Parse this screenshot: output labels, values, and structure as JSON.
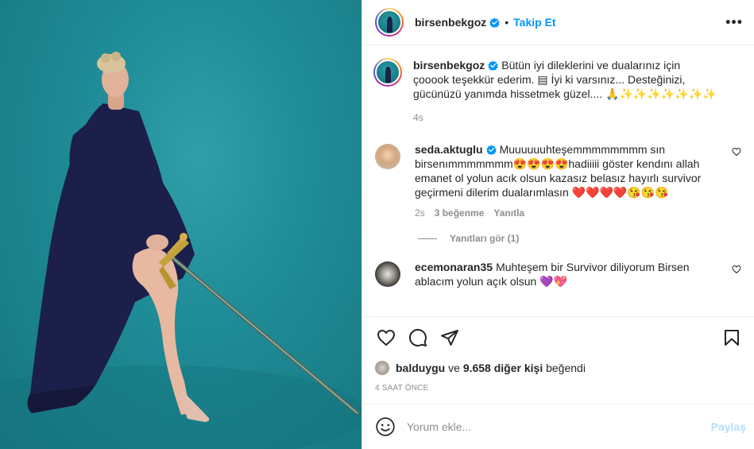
{
  "header": {
    "username": "birsenbekgoz",
    "separator": "•",
    "follow_label": "Takip Et",
    "more_label": "•••"
  },
  "caption": {
    "username": "birsenbekgoz",
    "text": "Bütün iyi dileklerini ve dualarınız için çooook teşekkür ederim. ▤ İyi ki varsınız... Desteğinizi, gücünüzü yanımda hissetmek güzel.... 🙏✨✨✨✨✨✨✨",
    "time": "4s"
  },
  "comments": [
    {
      "username": "seda.aktuglu",
      "text": "Muuuuuuhteşemmmmmmmm sın birsenımmmmmmm😍😍😍😍hadiiiii göster kendını allah emanet ol yolun acık olsun kazasız belasız hayırlı survivor geçirmeni dilerim dualarımlasın ❤️❤️❤️❤️😘😘😘",
      "time": "2s",
      "likes": "3 beğenme",
      "reply": "Yanıtla",
      "view_replies": "Yanıtları gör (1)"
    },
    {
      "username": "ecemonaran35",
      "text": "Muhteşem bir Survivor diliyorum Birsen ablacım yolun açık olsun 💜💖"
    }
  ],
  "likes": {
    "user": "balduygu",
    "connector": "ve",
    "others": "9.658 diğer kişi",
    "suffix": "beğendi"
  },
  "timestamp": "4 SAAT ÖNCE",
  "add_comment": {
    "placeholder": "Yorum ekle...",
    "post_label": "Paylaş"
  },
  "colors": {
    "accent": "#0095f6",
    "post_disabled": "#b2dffc",
    "secondary_text": "#8e8e8e",
    "backdrop": "#1f8c97"
  },
  "icons": [
    "heart-icon",
    "comment-icon",
    "share-icon",
    "bookmark-icon",
    "emoji-icon",
    "verified-badge-icon",
    "more-options-icon"
  ]
}
